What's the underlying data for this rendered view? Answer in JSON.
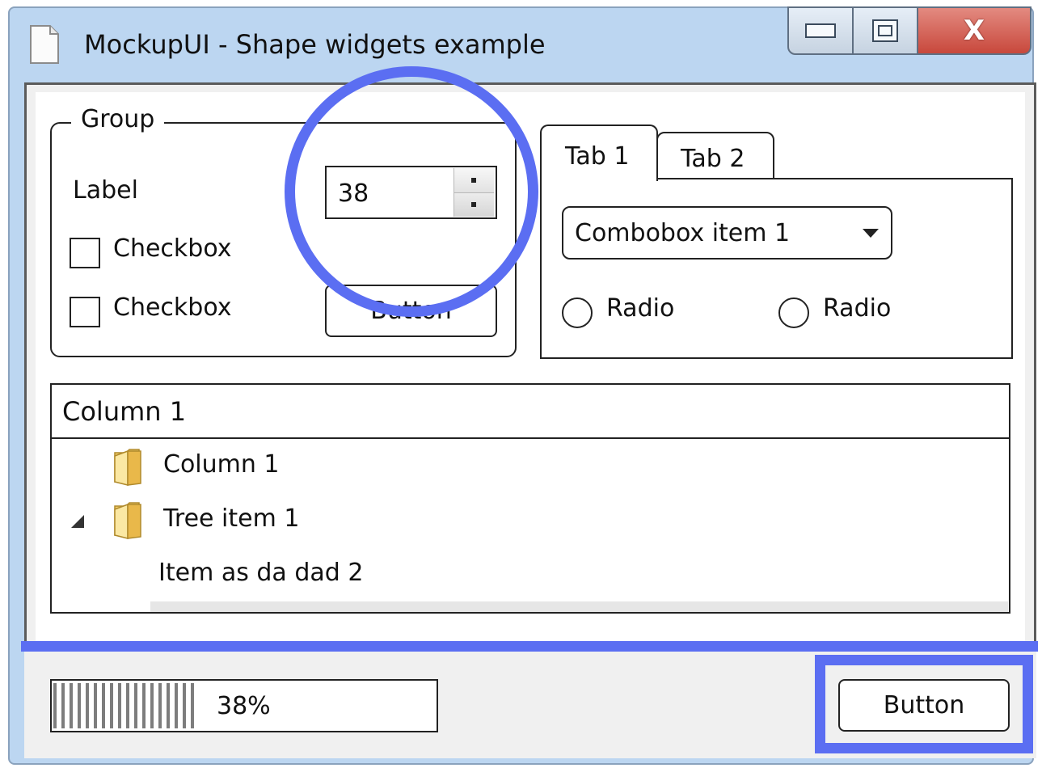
{
  "window": {
    "title": "MockupUI - Shape widgets example",
    "min_glyph": "▭",
    "max_glyph": "▣",
    "close_glyph": "X"
  },
  "group": {
    "legend": "Group",
    "label": "Label",
    "checkbox1_label": "Checkbox",
    "checkbox2_label": "Checkbox",
    "spin_value": "38",
    "button_label": "Button"
  },
  "tabs": {
    "items": [
      {
        "label": "Tab 1"
      },
      {
        "label": "Tab 2"
      }
    ],
    "combo_value": "Combobox item 1",
    "radio1_label": "Radio",
    "radio2_label": "Radio"
  },
  "tree": {
    "column_header": "Column 1",
    "rows": [
      {
        "label": "Column 1"
      },
      {
        "label": "Tree item 1"
      },
      {
        "label": "Item as da dad 2"
      }
    ]
  },
  "footer": {
    "progress_value": 38,
    "progress_text": "38%",
    "button_label": "Button"
  },
  "colors": {
    "highlight": "#5b6ef2",
    "window_frame": "#bcd6f1",
    "close_button": "#c8483c"
  }
}
